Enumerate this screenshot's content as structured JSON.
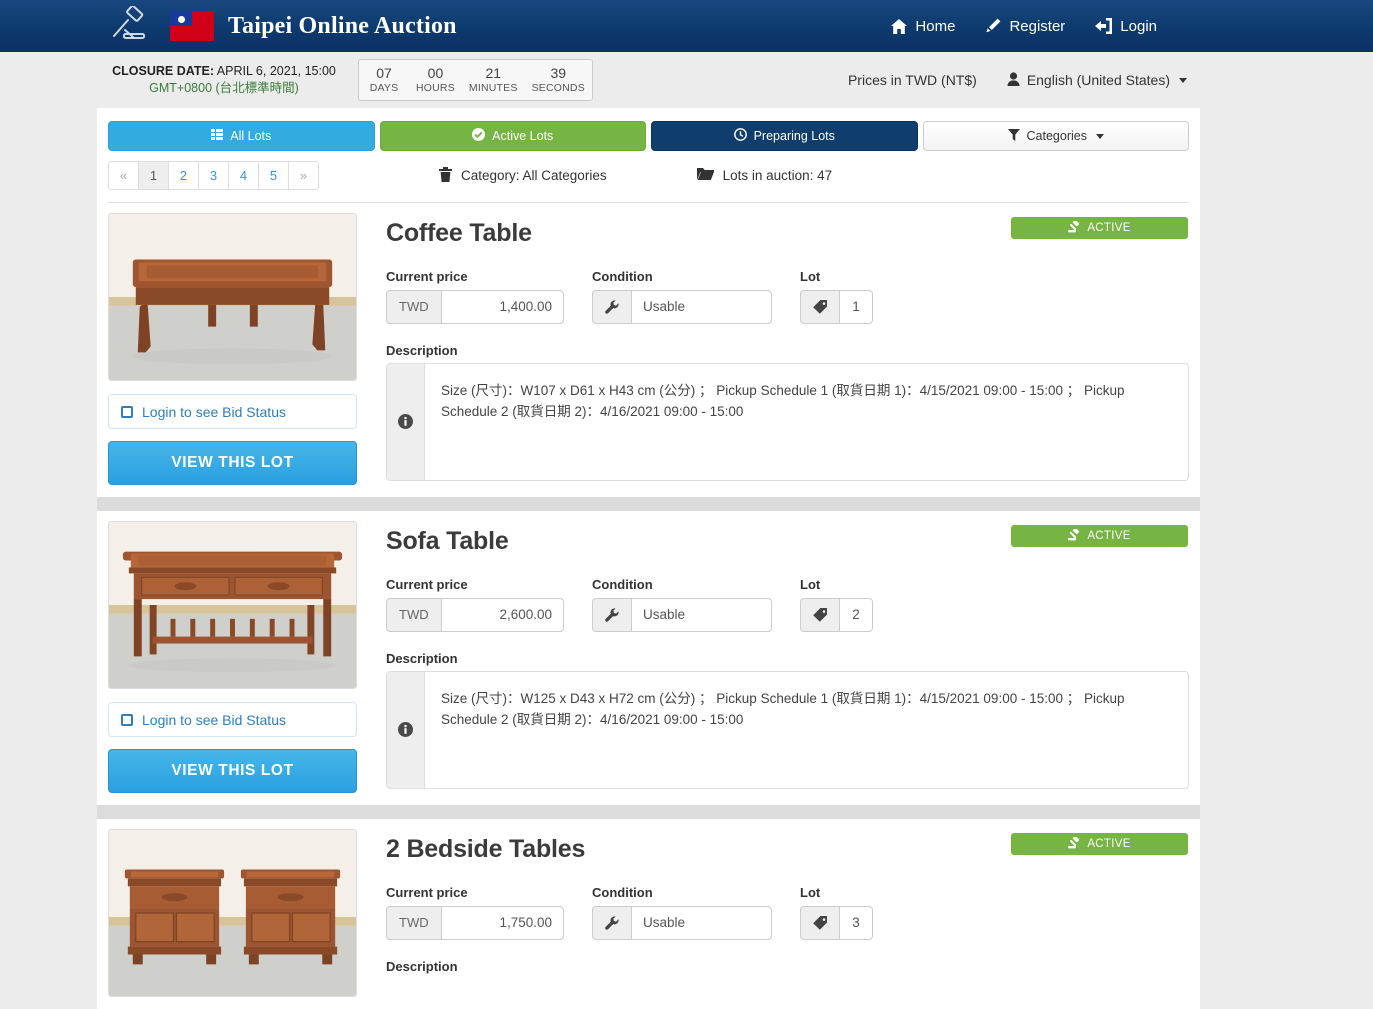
{
  "header": {
    "brand_title": "Taipei Online Auction",
    "logo_icon": "gavel-icon",
    "flag_icon": "taiwan-flag-icon",
    "nav": [
      {
        "label": "Home",
        "icon": "home-icon"
      },
      {
        "label": "Register",
        "icon": "pencil-icon"
      },
      {
        "label": "Login",
        "icon": "login-arrow-icon"
      }
    ]
  },
  "subbar": {
    "closure_prefix": "CLOSURE DATE:",
    "closure_date": " APRIL 6, 2021, 15:00",
    "timezone": "GMT+0800 (台北標準時間)",
    "countdown": [
      {
        "value": "07",
        "unit": "DAYS"
      },
      {
        "value": "00",
        "unit": "HOURS"
      },
      {
        "value": "21",
        "unit": "MINUTES"
      },
      {
        "value": "39",
        "unit": "SECONDS"
      }
    ],
    "prices_label": "Prices in TWD (NT$)",
    "language": "English (United States)",
    "language_icon": "user-icon"
  },
  "tabs": [
    {
      "label": "All Lots",
      "icon": "list-icon",
      "style": "blue"
    },
    {
      "label": "Active Lots",
      "icon": "check-circle-icon",
      "style": "green"
    },
    {
      "label": "Preparing Lots",
      "icon": "clock-icon",
      "style": "navy"
    },
    {
      "label": "Categories",
      "icon": "filter-icon",
      "style": "white"
    }
  ],
  "pagination": {
    "prev": "«",
    "pages": [
      "1",
      "2",
      "3",
      "4",
      "5"
    ],
    "next": "»",
    "active_page": "1"
  },
  "meta": {
    "category": "Category: All Categories",
    "category_icon": "trash-icon",
    "lots_count": "Lots in auction: 47",
    "lots_icon": "folder-icon"
  },
  "labels": {
    "current_price": "Current price",
    "condition": "Condition",
    "lot": "Lot",
    "description": "Description",
    "bid_status": "Login to see Bid Status",
    "view_lot": "VIEW THIS LOT",
    "active_badge": "ACTIVE",
    "badge_icon": "gavel-icon",
    "condition_icon": "wrench-icon",
    "lot_icon": "tag-icon",
    "desc_icon": "info-icon",
    "checkbox_icon": "checkbox-icon"
  },
  "lots": [
    {
      "title": "Coffee Table",
      "status": "ACTIVE",
      "currency": "TWD",
      "price": "1,400.00",
      "condition": "Usable",
      "lot_number": "1",
      "description": "Size (尺寸)：W107 x D61 x H43 cm (公分) ； Pickup Schedule 1 (取貨日期 1)：4/15/2021 09:00 - 15:00 ； Pickup Schedule 2 (取貨日期 2)：4/16/2021 09:00 - 15:00",
      "image": "coffee-table-photo"
    },
    {
      "title": "Sofa Table",
      "status": "ACTIVE",
      "currency": "TWD",
      "price": "2,600.00",
      "condition": "Usable",
      "lot_number": "2",
      "description": "Size (尺寸)：W125 x D43 x H72 cm (公分) ； Pickup Schedule 1 (取貨日期 1)：4/15/2021 09:00 - 15:00 ； Pickup Schedule 2 (取貨日期 2)：4/16/2021 09:00 - 15:00",
      "image": "sofa-table-photo"
    },
    {
      "title": "2 Bedside Tables",
      "status": "ACTIVE",
      "currency": "TWD",
      "price": "1,750.00",
      "condition": "Usable",
      "lot_number": "3",
      "description": "",
      "image": "bedside-tables-photo"
    }
  ],
  "colors": {
    "header_blue": "#0d3a6e",
    "accent_blue": "#33aae0",
    "active_green": "#76b543",
    "navy": "#0e3d6e",
    "page_bg": "#ececec"
  }
}
